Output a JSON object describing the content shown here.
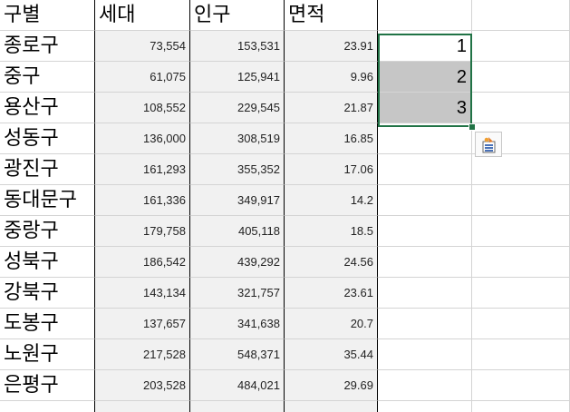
{
  "headers": [
    "구별",
    "세대",
    "인구",
    "면적",
    ""
  ],
  "rows": [
    {
      "district": "종로구",
      "households": "73,554",
      "population": "153,531",
      "area": "23.91",
      "fill": "1"
    },
    {
      "district": "중구",
      "households": "61,075",
      "population": "125,941",
      "area": "9.96",
      "fill": "2"
    },
    {
      "district": "용산구",
      "households": "108,552",
      "population": "229,545",
      "area": "21.87",
      "fill": "3"
    },
    {
      "district": "성동구",
      "households": "136,000",
      "population": "308,519",
      "area": "16.85",
      "fill": ""
    },
    {
      "district": "광진구",
      "households": "161,293",
      "population": "355,352",
      "area": "17.06",
      "fill": ""
    },
    {
      "district": "동대문구",
      "households": "161,336",
      "population": "349,917",
      "area": "14.2",
      "fill": ""
    },
    {
      "district": "중랑구",
      "households": "179,758",
      "population": "405,118",
      "area": "18.5",
      "fill": ""
    },
    {
      "district": "성북구",
      "households": "186,542",
      "population": "439,292",
      "area": "24.56",
      "fill": ""
    },
    {
      "district": "강북구",
      "households": "143,134",
      "population": "321,757",
      "area": "23.61",
      "fill": ""
    },
    {
      "district": "도봉구",
      "households": "137,657",
      "population": "341,638",
      "area": "20.7",
      "fill": ""
    },
    {
      "district": "노원구",
      "households": "217,528",
      "population": "548,371",
      "area": "35.44",
      "fill": ""
    },
    {
      "district": "은평구",
      "households": "203,528",
      "population": "484,021",
      "area": "29.69",
      "fill": ""
    }
  ],
  "colors": {
    "selection_border": "#217346",
    "data_fill": "#f1f1f1",
    "selected_fill": "#c6c6c6",
    "gridline": "#d4d4d4"
  },
  "icons": {
    "quick_action": "auto-fill-options-icon"
  }
}
